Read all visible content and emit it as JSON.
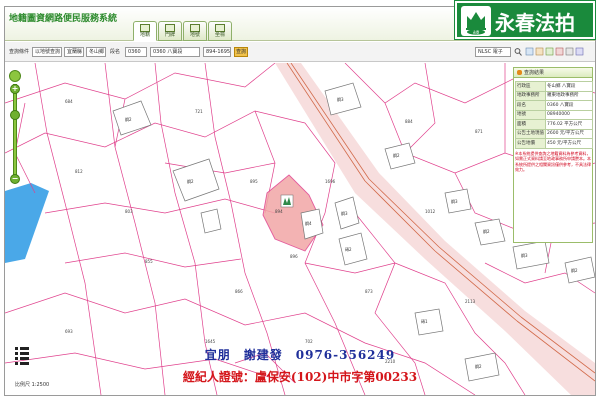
{
  "header": {
    "app_title": "地籍圖資網路便民服務系統",
    "tabs": [
      {
        "label": "地籍",
        "active": true
      },
      {
        "label": "門牌",
        "active": false
      },
      {
        "label": "地號",
        "active": false
      },
      {
        "label": "坐標",
        "active": false
      }
    ]
  },
  "logo": {
    "text": "永春法拍",
    "emblem_label": "永春",
    "emblem_icon": "agency-emblem-icon"
  },
  "toolbar": {
    "search_type_label": "查詢條件",
    "county_select": "以地號查詢",
    "district_select": "宜蘭縣",
    "town_select": "冬山鄉",
    "section_label": "段名",
    "section_code": "0360",
    "section_select": "0360 八寶段",
    "lot_number": "894-1695",
    "query_button": "查詢",
    "basemap_select": "NLSC 電子",
    "search_icon": "search-icon",
    "layer_icon": "layers-icon"
  },
  "map": {
    "building_labels": [
      "鋼2",
      "鋼2",
      "鋼3",
      "鋼3",
      "磚2",
      "鋼4",
      "鋼2",
      "鋼3",
      "鋼2",
      "磚1",
      "鋼2",
      "鋼3",
      "鋼2"
    ],
    "parcel_labels": [
      "894",
      "895",
      "896",
      "873",
      "866",
      "855",
      "812",
      "721",
      "693",
      "884",
      "871",
      "863",
      "1012",
      "2113",
      "1645",
      "702",
      "803",
      "684",
      "2210",
      "1696"
    ]
  },
  "zoom": {
    "zoom_in": "+",
    "zoom_out": "−",
    "level": 0.82
  },
  "panel": {
    "title": "查詢結果",
    "rows": [
      {
        "key": "行政區",
        "value": "冬山鄉 八寶段"
      },
      {
        "key": "地政事務所",
        "value": "羅東地政事務所"
      },
      {
        "key": "段名",
        "value": "0360 八寶段"
      },
      {
        "key": "地號",
        "value": "08940000"
      },
      {
        "key": "面積",
        "value": "776.02 平方公尺"
      },
      {
        "key": "公告土地現值",
        "value": "2600 元/平方公尺"
      },
      {
        "key": "公告地價",
        "value": "450 元/平方公尺"
      }
    ],
    "note": "※本系統提供查詢之地籍資料為參考資料，如需正式資料請至地政事務所申請謄本。本系統所提供之相關資訊僅供參考，不具法律效力。"
  },
  "scale": {
    "text": "比例尺 1:2500"
  },
  "overlay": {
    "contact": "宜朋　謝建發　0976-356249",
    "license": "經紀人證號：盧保安(102)中市字第00233"
  },
  "colors": {
    "parcel_line": "#e0408c",
    "highlight": "#f2a6a6",
    "road": "#f3c9c9",
    "water": "#4aa8e8",
    "building": "#ffffff",
    "accent_green": "#1a8a3c"
  }
}
